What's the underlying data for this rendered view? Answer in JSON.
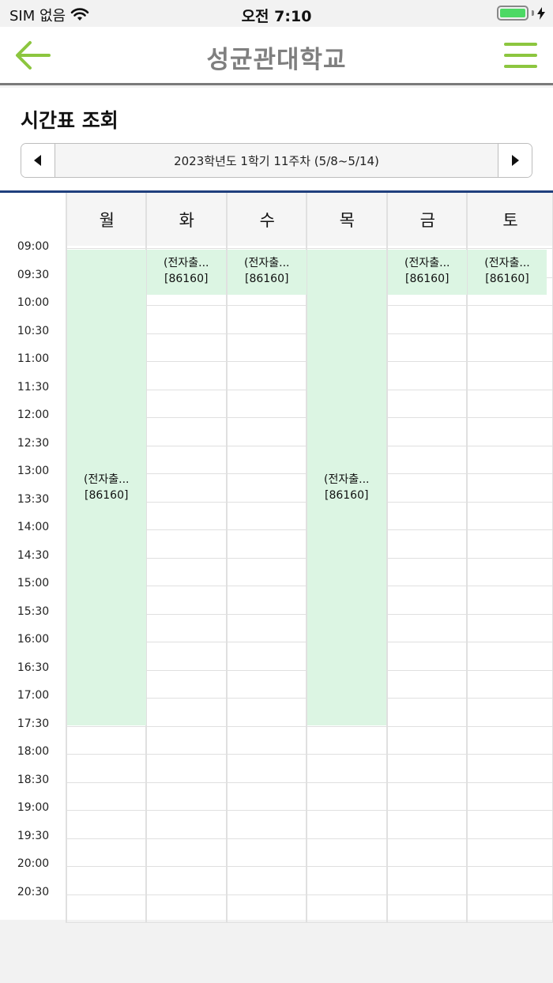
{
  "status_bar": {
    "carrier": "SIM 없음",
    "time": "오전 7:10"
  },
  "header": {
    "title": "성균관대학교",
    "back_icon": "arrow-left-icon",
    "menu_icon": "hamburger-menu-icon",
    "accent_color": "#8cc63f"
  },
  "page": {
    "title": "시간표 조회"
  },
  "week_nav": {
    "label": "2023학년도 1학기 11주차 (5/8~5/14)"
  },
  "timetable": {
    "days": [
      "월",
      "화",
      "수",
      "목",
      "금",
      "토"
    ],
    "times": [
      "09:00",
      "09:30",
      "10:00",
      "10:30",
      "11:00",
      "11:30",
      "12:00",
      "12:30",
      "13:00",
      "13:30",
      "14:00",
      "14:30",
      "15:00",
      "15:30",
      "16:00",
      "16:30",
      "17:00",
      "17:30",
      "18:00",
      "18:30",
      "19:00",
      "19:30",
      "20:00",
      "20:30"
    ],
    "block_color": "#dcf5e3",
    "classes": [
      {
        "day": "월",
        "title": "(전자출...",
        "code": "[86160]",
        "start": "09:00",
        "end": "17:30"
      },
      {
        "day": "화",
        "title": "(전자출...",
        "code": "[86160]",
        "start": "09:00",
        "end": "09:50"
      },
      {
        "day": "수",
        "title": "(전자출...",
        "code": "[86160]",
        "start": "09:00",
        "end": "09:50"
      },
      {
        "day": "목",
        "title": "(전자출...",
        "code": "[86160]",
        "start": "09:00",
        "end": "17:30"
      },
      {
        "day": "금",
        "title": "(전자출...",
        "code": "[86160]",
        "start": "09:00",
        "end": "09:50"
      },
      {
        "day": "토",
        "title": "(전자출...",
        "code": "[86160]",
        "start": "09:00",
        "end": "09:50"
      }
    ]
  }
}
